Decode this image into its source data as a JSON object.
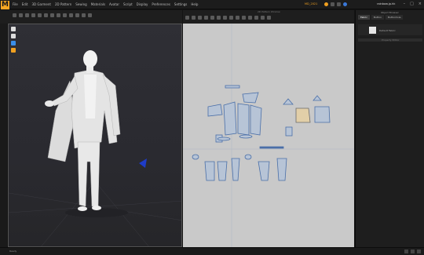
{
  "app": {
    "logo": "M",
    "menus": [
      "File",
      "Edit",
      "3D Garment",
      "2D Pattern",
      "Sewing",
      "Materials",
      "Avatar",
      "Script",
      "Display",
      "Preferences",
      "Settings",
      "Help"
    ],
    "title_center": "MD_2021",
    "user": "rainbow.jp.hk",
    "window_controls": [
      "–",
      "□",
      "×"
    ]
  },
  "toolbar_2d": {
    "title": "2D Pattern Window"
  },
  "right_panel": {
    "title": "Object Browser",
    "tabs": [
      "Fabric",
      "Button",
      "Buttonhole"
    ],
    "fabric_item": "Default Fabric",
    "section_label": "Property Editor"
  },
  "status": {
    "left": "Ready"
  },
  "colors": {
    "accent": "#f0a020",
    "viewport3d_bg": "#2c2c32",
    "viewport2d_bg": "#c9c9c9",
    "pattern_fill": "#b7c4d6",
    "pattern_stroke": "#4a6fa8"
  },
  "icons": [
    "sun-icon",
    "avatar-icon",
    "fabric-icon",
    "light-icon",
    "arrow-gizmo-icon"
  ]
}
